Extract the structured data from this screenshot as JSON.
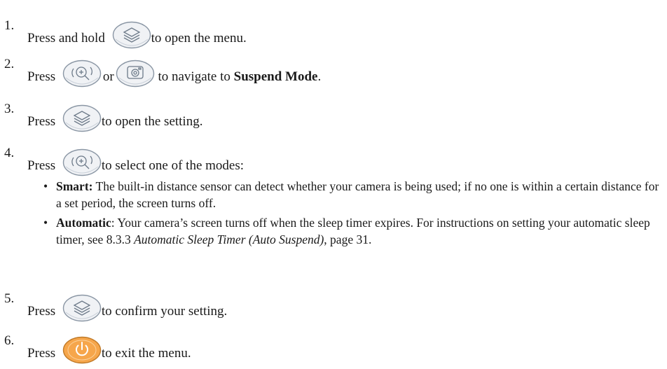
{
  "steps": [
    {
      "num": "1.",
      "before": "Press and hold",
      "after": "to open the menu."
    },
    {
      "num": "2.",
      "before": "Press",
      "mid": "or",
      "after": "to navigate to",
      "bold": "Suspend Mode",
      "end": "."
    },
    {
      "num": "3.",
      "before": "Press",
      "after": "to open the setting."
    },
    {
      "num": "4.",
      "before": "Press",
      "after": "to select one of the modes:"
    },
    {
      "num": "5.",
      "before": "Press",
      "after": "to confirm your setting."
    },
    {
      "num": "6.",
      "before": "Press",
      "after": "to exit the menu."
    }
  ],
  "bullets": [
    {
      "bold": "Smart:",
      "text": " The built-in distance sensor can detect whether your camera is being used; if no one is within a certain distance for a set period, the screen turns off."
    },
    {
      "bold": "Automatic",
      "text1": ": Your camera’s screen turns off when the sleep timer expires. For instructions on setting your automatic sleep timer, see 8.3.3 ",
      "italic": "Automatic Sleep Timer (Auto Suspend)",
      "text2": ", page 31."
    }
  ],
  "bullet_glyph": "•",
  "icons": {
    "menu": "layers-icon",
    "zoom": "zoom-in-icon",
    "camera": "camera-icon",
    "power": "power-icon"
  },
  "colors": {
    "button_fill": "#f0f2f5",
    "button_stroke": "#8a96a4",
    "power_fill": "#f6a64b",
    "power_stroke": "#c07a28"
  }
}
